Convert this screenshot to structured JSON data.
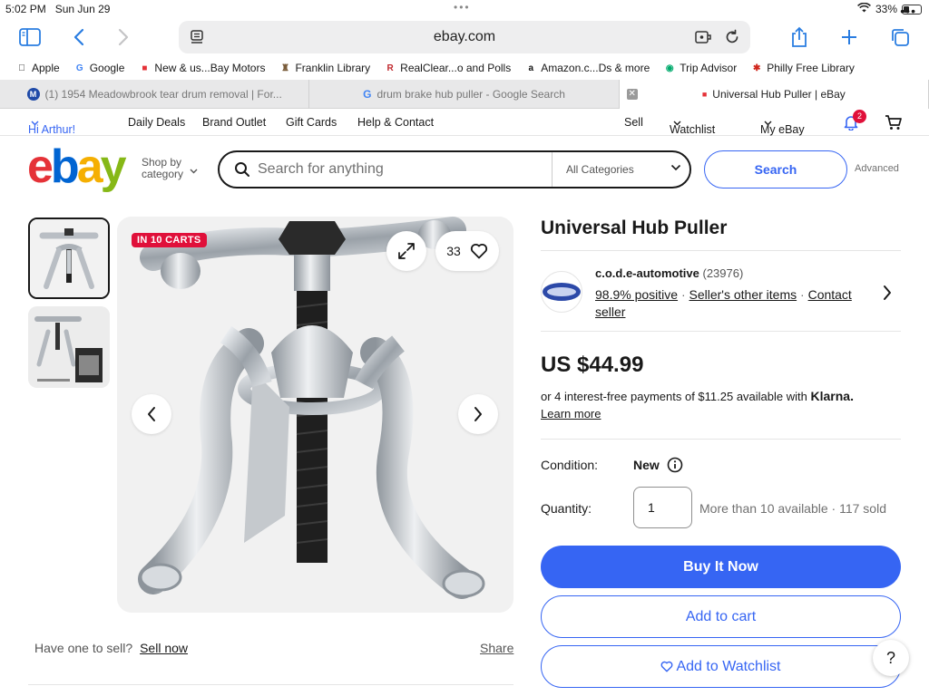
{
  "status_bar": {
    "time": "5:02 PM",
    "date": "Sun Jun 29",
    "battery": "33%",
    "battery_level": 0.33
  },
  "browser": {
    "url": "ebay.com"
  },
  "bookmarks": [
    {
      "label": "Apple",
      "icon": "apple-icon",
      "icon_text": "",
      "color": "#222222"
    },
    {
      "label": "Google",
      "icon": "google-icon",
      "icon_text": "G",
      "color": "#4285f4"
    },
    {
      "label": "New & us...Bay Motors",
      "icon": "ebay-motors-icon",
      "icon_text": "■",
      "color": "#e53238"
    },
    {
      "label": "Franklin Library",
      "icon": "library-icon",
      "icon_text": "♜",
      "color": "#7a5c3a"
    },
    {
      "label": "RealClear...o and Polls",
      "icon": "realclear-icon",
      "icon_text": "R",
      "color": "#c0282d"
    },
    {
      "label": "Amazon.c...Ds & more",
      "icon": "amazon-icon",
      "icon_text": "a",
      "color": "#111111"
    },
    {
      "label": "Trip Advisor",
      "icon": "tripadvisor-icon",
      "icon_text": "◉",
      "color": "#00aa6c"
    },
    {
      "label": "Philly Free Library",
      "icon": "philly-library-icon",
      "icon_text": "✱",
      "color": "#d0261c"
    }
  ],
  "tabs": [
    {
      "label": "(1) 1954 Meadowbrook tear drum removal | For...",
      "icon_text": "M",
      "icon_color": "#1f4aa8"
    },
    {
      "label": "drum brake hub puller - Google Search",
      "icon_text": "G",
      "icon_color": "#4285f4"
    },
    {
      "label": "Universal Hub Puller | eBay",
      "icon_text": "■",
      "icon_color": "#e53238"
    }
  ],
  "ebay_nav": {
    "greeting": "Hi Arthur!",
    "links": [
      "Daily Deals",
      "Brand Outlet",
      "Gift Cards",
      "Help & Contact"
    ],
    "sell": "Sell",
    "watchlist": "Watchlist",
    "my_ebay": "My eBay",
    "notification_count": "2"
  },
  "header": {
    "logo": [
      "e",
      "b",
      "a",
      "y"
    ],
    "shop_by_line1": "Shop by",
    "shop_by_line2": "category",
    "search_placeholder": "Search for anything",
    "category": "All Categories",
    "search_button": "Search",
    "advanced": "Advanced"
  },
  "gallery": {
    "badge": "IN 10 CARTS",
    "watch_count": "33"
  },
  "listing": {
    "title": "Universal Hub Puller",
    "seller_name": "c.o.d.e-automotive",
    "seller_feedback_count": "(23976)",
    "positive": "98.9% positive",
    "other_items": "Seller's other items",
    "contact": "Contact seller",
    "sep": "·",
    "price": "US $44.99",
    "installments": "or 4 interest-free payments of $11.25 available with",
    "klarna": "Klarna.",
    "learn_more": "Learn more",
    "condition_label": "Condition:",
    "condition_value": "New",
    "quantity_label": "Quantity:",
    "quantity_value": "1",
    "availability": "More than 10 available · 117 sold",
    "buy_now": "Buy It Now",
    "add_to_cart": "Add to cart",
    "add_to_watchlist": "Add to Watchlist"
  },
  "below_gallery": {
    "have_one": "Have one to sell?",
    "sell_now": "Sell now",
    "share": "Share"
  },
  "help": "?",
  "colors": {
    "ebay_blue": "#3665f3",
    "badge_red": "#e0103a",
    "safari_blue": "#2a7de1"
  }
}
